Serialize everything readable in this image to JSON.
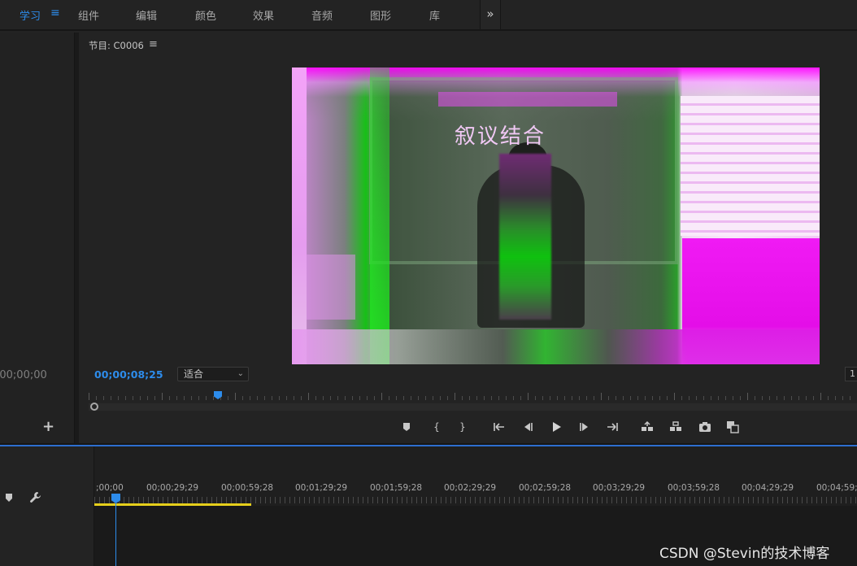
{
  "workspace_tabs": [
    {
      "label": "学习",
      "active": true
    },
    {
      "label": "组件",
      "active": false
    },
    {
      "label": "编辑",
      "active": false
    },
    {
      "label": "颜色",
      "active": false
    },
    {
      "label": "效果",
      "active": false
    },
    {
      "label": "音频",
      "active": false
    },
    {
      "label": "图形",
      "active": false
    },
    {
      "label": "库",
      "active": false
    }
  ],
  "workspace_menu_glyph": "≡",
  "more_workspaces_glyph": "»",
  "source_panel": {
    "timecode": ";00;00;00",
    "add_glyph": "+"
  },
  "program_monitor": {
    "title": "节目: C0006",
    "menu_glyph": "≡",
    "video_chalk_text": "叙议结合",
    "timecode": "00;00;08;25",
    "fit_select": "适合",
    "resolution_stub": "1",
    "playhead_fraction": 0.163
  },
  "transport_controls": [
    {
      "name": "add-marker-icon"
    },
    {
      "name": "mark-in-icon",
      "glyph": "{"
    },
    {
      "name": "mark-out-icon",
      "glyph": "}"
    },
    {
      "name": "go-to-in-icon"
    },
    {
      "name": "step-back-icon"
    },
    {
      "name": "play-icon"
    },
    {
      "name": "step-forward-icon"
    },
    {
      "name": "go-to-out-icon"
    },
    {
      "name": "lift-icon"
    },
    {
      "name": "extract-icon"
    },
    {
      "name": "export-frame-icon"
    },
    {
      "name": "comparison-view-icon"
    }
  ],
  "timeline": {
    "ruler_labels": [
      ";00;00",
      "00;00;29;29",
      "00;00;59;28",
      "00;01;29;29",
      "00;01;59;28",
      "00;02;29;29",
      "00;02;59;28",
      "00;03;29;29",
      "00;03;59;28",
      "00;04;29;29",
      "00;04;59;29"
    ]
  },
  "colors": {
    "accent_blue": "#2d8ceb",
    "work_area_yellow": "#e6cf1b"
  },
  "watermark": "CSDN @Stevin的技术博客"
}
